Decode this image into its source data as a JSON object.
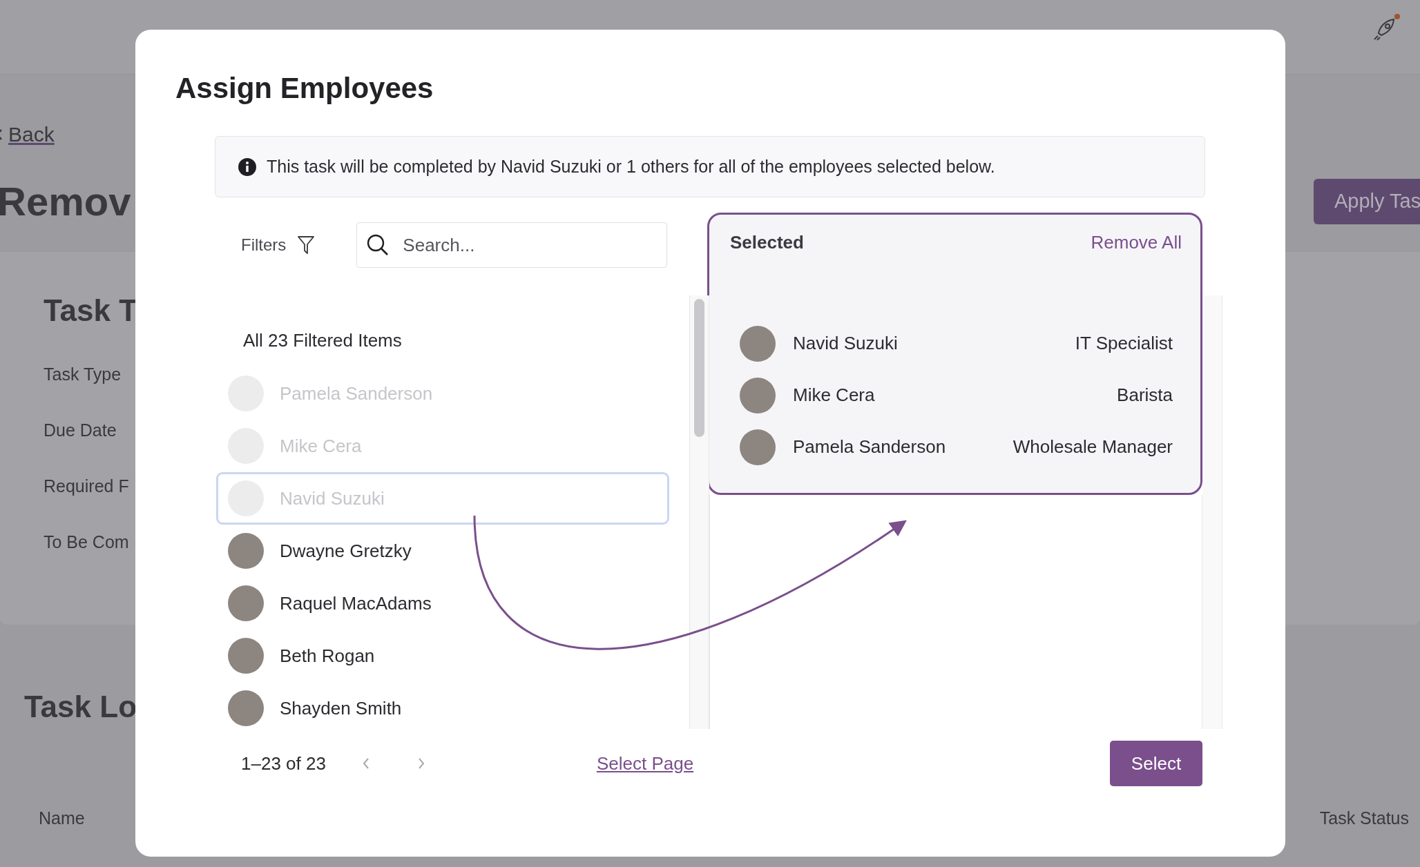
{
  "background": {
    "back_link": "Back",
    "title": "Remov",
    "apply_button": "Apply Tas",
    "card": {
      "title": "Task T",
      "fields": [
        "Task Type",
        "Due Date",
        "Required F",
        "To Be Com"
      ]
    },
    "log_title": "Task Lo",
    "table_columns": [
      "Name",
      "Task Status"
    ]
  },
  "dialog": {
    "title": "Assign Employees",
    "info": "This task will be completed by Navid Suzuki or 1 others for all of the employees selected below.",
    "filters_label": "Filters",
    "search": {
      "placeholder": "Search..."
    },
    "list_header": "All 23 Filtered Items",
    "employees": [
      {
        "name": "Pamela Sanderson",
        "disabled": true,
        "focused": false
      },
      {
        "name": "Mike Cera",
        "disabled": true,
        "focused": false
      },
      {
        "name": "Navid Suzuki",
        "disabled": true,
        "focused": true
      },
      {
        "name": "Dwayne Gretzky",
        "disabled": false,
        "focused": false
      },
      {
        "name": "Raquel MacAdams",
        "disabled": false,
        "focused": false
      },
      {
        "name": "Beth Rogan",
        "disabled": false,
        "focused": false
      },
      {
        "name": "Shayden Smith",
        "disabled": false,
        "focused": false
      }
    ],
    "selected_panel": {
      "title": "Selected",
      "remove_all": "Remove All",
      "items": [
        {
          "name": "Navid Suzuki",
          "role": "IT Specialist"
        },
        {
          "name": "Mike Cera",
          "role": "Barista"
        },
        {
          "name": "Pamela Sanderson",
          "role": "Wholesale Manager"
        }
      ]
    },
    "pagination": {
      "range": "1–23 of 23"
    },
    "select_page": "Select Page",
    "select_button": "Select"
  }
}
